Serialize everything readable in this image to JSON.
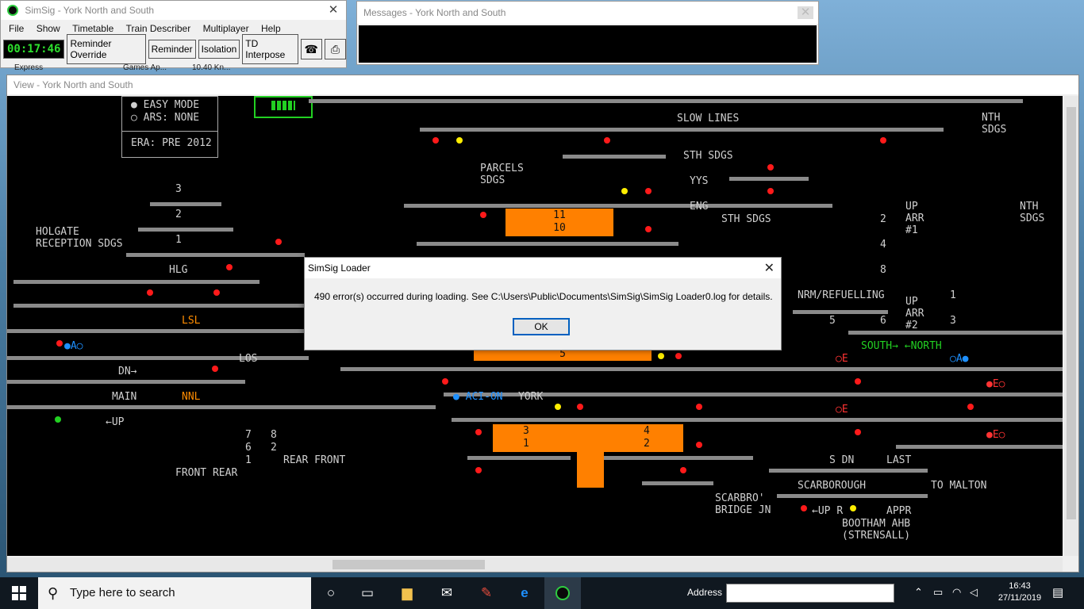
{
  "main_window": {
    "title": "SimSig - York North and South",
    "menu": [
      "File",
      "Show",
      "Timetable",
      "Train Describer",
      "Multiplayer",
      "Help"
    ],
    "clock": "00:17:46",
    "buttons": [
      "Reminder Override",
      "Reminder",
      "Isolation",
      "TD Interpose"
    ],
    "icon_buttons": [
      "telephone-icon",
      "printer-icon"
    ]
  },
  "messages_window": {
    "title": "Messages - York North and South"
  },
  "view_window": {
    "title": "View - York North and South"
  },
  "peek_text": {
    "a": "Express",
    "b": "Games Ap...",
    "c": "10.40 Kn..."
  },
  "panel": {
    "easy_mode": "EASY MODE",
    "ars": "ARS: NONE",
    "era": "ERA: PRE 2012",
    "labels": {
      "slow_lines": "SLOW LINES",
      "nth_sdgs": "NTH\nSDGS",
      "nth_sdgs2": "NTH\nSDGS",
      "sth_sdgs_top": "STH SDGS",
      "parcels": "PARCELS\nSDGS",
      "yys": "YYS",
      "eng": "ENG",
      "sth_sdgs": "STH SDGS",
      "up_arr1": "UP\nARR\n#1",
      "holgate": "HOLGATE\nRECEPTION SDGS",
      "hlg": "HLG",
      "lsl": "LSL",
      "los": "LOS",
      "dn": "DN",
      "main": "MAIN",
      "nnl": "NNL",
      "up": "UP",
      "aci_on": "ACI-ON",
      "york": "YORK",
      "nrm": "NRM/REFUELLING",
      "up_arr2": "UP\nARR\n#2",
      "south_north": "SOUTH→ ←NORTH",
      "last": "LAST",
      "scarborough": "SCARBOROUGH",
      "to_malton": "TO MALTON",
      "scarbro_bridge": "SCARBRO'\nBRIDGE JN",
      "appr": "APPR",
      "bootham": "BOOTHAM AHB\n(STRENSALL)",
      "front_rear_left": "FRONT REAR",
      "rear_front_right": "REAR FRONT",
      "n3": "3",
      "n2": "2",
      "n1": "1",
      "p7": "7",
      "p6": "6",
      "p1": "1",
      "p8": "8",
      "p2": "2",
      "r2": "2",
      "r4": "4",
      "r8": "8",
      "r1": "1",
      "r3": "3",
      "r5": "5",
      "r6": "6",
      "a_blue": "A",
      "a_blue2": "A",
      "e_red": "E",
      "e_red2": "E",
      "e_red3": "E",
      "e_red4": "E",
      "s_dn": "S DN",
      "up2": "UP",
      "r_lbl": "R"
    },
    "berths": {
      "b11": "11",
      "b10": "10",
      "b5": "5",
      "b3": "3",
      "b4": "4",
      "b1": "1",
      "b2": "2"
    }
  },
  "dialog": {
    "title": "SimSig Loader",
    "message": "490 error(s) occurred during loading. See C:\\Users\\Public\\Documents\\SimSig\\SimSig Loader0.log for details.",
    "ok": "OK"
  },
  "taskbar": {
    "search_placeholder": "Type here to search",
    "address_label": "Address",
    "time": "16:43",
    "date": "27/11/2019"
  }
}
